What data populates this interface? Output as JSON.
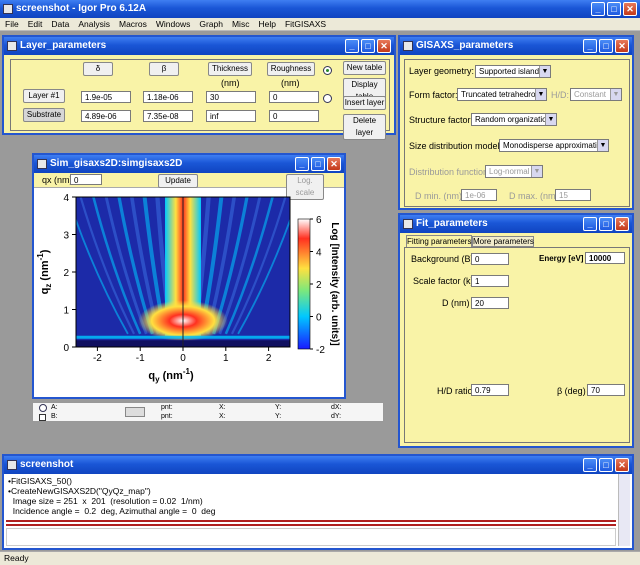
{
  "app": {
    "title": "screenshot - Igor Pro 6.12A"
  },
  "menu": [
    "File",
    "Edit",
    "Data",
    "Analysis",
    "Macros",
    "Windows",
    "Graph",
    "Misc",
    "Help",
    "FitGISAXS"
  ],
  "layer_window": {
    "title": "Layer_parameters",
    "col_delta": "δ",
    "col_beta": "β",
    "col_thickness": "Thickness",
    "col_roughness": "Roughness",
    "unit_thickness": "(nm)",
    "unit_roughness": "(nm)",
    "rows": [
      {
        "name": "Layer #1",
        "delta": "1.9e-05",
        "beta": "1.18e-06",
        "thickness": "30",
        "roughness": "0"
      },
      {
        "name": "Substrate",
        "delta": "4.89e-06",
        "beta": "7.35e-08",
        "thickness": "inf",
        "roughness": "0"
      }
    ],
    "buttons": {
      "new_table": "New table",
      "display_table": "Display table",
      "insert_layer": "Insert layer",
      "delete_layer": "Delete layer"
    }
  },
  "gisaxs_window": {
    "title": "GISAXS_parameters",
    "layer_geometry_label": "Layer geometry:",
    "layer_geometry": "Supported islands",
    "form_factor_label": "Form factor:",
    "form_factor": "Truncated tetrahedron",
    "hd_label": "H/D:",
    "hd_value": "Constant",
    "structure_factor_label": "Structure factor:",
    "structure_factor": "Random organization",
    "size_dist_label": "Size distribution model:",
    "size_dist": "Monodisperse approximation",
    "dist_function_label": "Distribution function:",
    "dist_function": "Log-normal",
    "dmin_label": "D min. (nm)",
    "dmin_value": "1e-06",
    "dmax_label": "D max. (nm)",
    "dmax_value": "15"
  },
  "sim_window": {
    "title": "Sim_gisaxs2D:simgisaxs2D",
    "qx_label": "qx (nm)",
    "qx_value": "0",
    "update": "Update",
    "log_scale": "Log. scale",
    "info": {
      "a": "A:",
      "b": "B:",
      "pnt": "pnt:",
      "x": "X:",
      "y": "Y:",
      "dx": "dX:",
      "dy": "dY:"
    }
  },
  "fit_window": {
    "title": "Fit_parameters",
    "tab_fitting": "Fitting parameters",
    "tab_more": "More parameters",
    "background_label": "Background (B)",
    "background": "0",
    "energy_label": "Energy [eV]",
    "energy": "10000",
    "scale_label": "Scale factor (k)",
    "scale": "1",
    "d_label": "D (nm)",
    "d_value": "20",
    "hd_ratio_label": "H/D ratio",
    "hd_ratio": "0.79",
    "beta_label": "β (deg)",
    "beta_value": "70"
  },
  "history_window": {
    "title": "screenshot",
    "lines": [
      "•FitGISAXS_50()",
      "•CreateNewGISAXS2D(\"QyQz_map\")",
      "  Image size = 251  x  201  (resolution = 0.02  1/nm)",
      "  Incidence angle =  0.2  deg, Azimuthal angle =  0  deg"
    ]
  },
  "status": {
    "text": "Ready"
  },
  "chart_data": {
    "type": "heatmap",
    "xlabel": "q",
    "xlabel_sub": "y",
    "xlabel_unit": "(nm",
    "xlabel_exp": "-1",
    "xlabel_close": ")",
    "ylabel": "q",
    "ylabel_sub": "z",
    "ylabel_unit": "(nm",
    "ylabel_exp": "-1",
    "ylabel_close": ")",
    "x_ticks": [
      "-2",
      "-1",
      "0",
      "1",
      "2"
    ],
    "y_ticks": [
      "0",
      "1",
      "2",
      "3",
      "4"
    ],
    "xlim": [
      -2.5,
      2.5
    ],
    "ylim": [
      0,
      4
    ],
    "colorbar_label": "Log [Intensity (arb. units)]",
    "colorbar_ticks": [
      "-2",
      "0",
      "2",
      "4",
      "6"
    ],
    "colorbar_range": [
      -2,
      6
    ],
    "colors": {
      "low": "#1a1aff",
      "mid_low": "#00c8ff",
      "mid": "#7ce87c",
      "mid_high": "#ffe040",
      "high": "#ff3020",
      "top": "#ffffff"
    }
  }
}
